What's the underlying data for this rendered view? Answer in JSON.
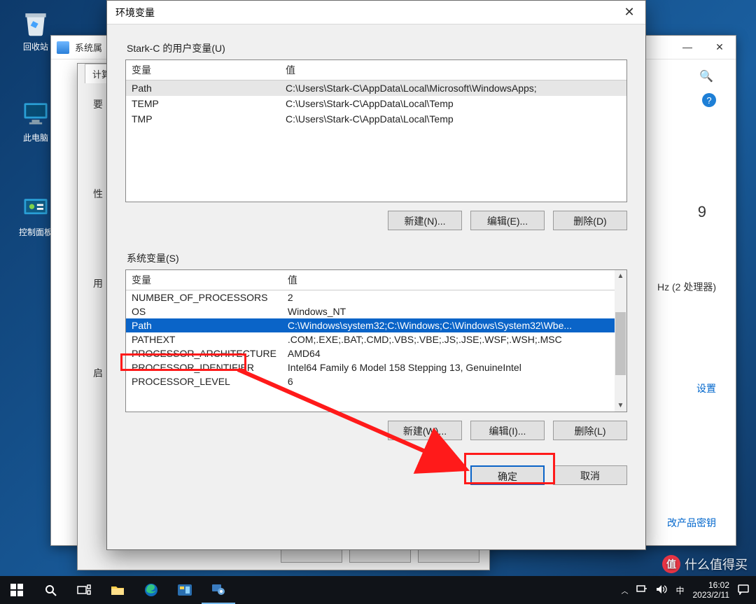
{
  "desktop": {
    "recycle": "回收站",
    "thispc": "此电脑",
    "cpanel": "控制面板"
  },
  "sys_window": {
    "title": "系统属",
    "search_glyph": "🔍",
    "help_glyph": "?",
    "minimize": "—",
    "close": "✕",
    "hz_note": "Hz  (2 处理器)",
    "nine": "9",
    "link_settings": "设置",
    "link_product": "改产品密钥"
  },
  "sub2": {
    "tab": "计算",
    "left_items": [
      "要",
      "性",
      "用",
      "启"
    ]
  },
  "dlg": {
    "title": "环境变量",
    "close": "✕",
    "user_section": "Stark-C 的用户变量(U)",
    "sys_section": "系统变量(S)",
    "col_var": "变量",
    "col_val": "值",
    "user_rows": [
      {
        "var": "Path",
        "val": "C:\\Users\\Stark-C\\AppData\\Local\\Microsoft\\WindowsApps;"
      },
      {
        "var": "TEMP",
        "val": "C:\\Users\\Stark-C\\AppData\\Local\\Temp"
      },
      {
        "var": "TMP",
        "val": "C:\\Users\\Stark-C\\AppData\\Local\\Temp"
      }
    ],
    "sys_rows": [
      {
        "var": "NUMBER_OF_PROCESSORS",
        "val": "2"
      },
      {
        "var": "OS",
        "val": "Windows_NT"
      },
      {
        "var": "Path",
        "val": "C:\\Windows\\system32;C:\\Windows;C:\\Windows\\System32\\Wbe..."
      },
      {
        "var": "PATHEXT",
        "val": ".COM;.EXE;.BAT;.CMD;.VBS;.VBE;.JS;.JSE;.WSF;.WSH;.MSC"
      },
      {
        "var": "PROCESSOR_ARCHITECTURE",
        "val": "AMD64"
      },
      {
        "var": "PROCESSOR_IDENTIFIER",
        "val": "Intel64 Family 6 Model 158 Stepping 13, GenuineIntel"
      },
      {
        "var": "PROCESSOR_LEVEL",
        "val": "6"
      }
    ],
    "btn_new_u": "新建(N)...",
    "btn_edit_u": "编辑(E)...",
    "btn_del_u": "删除(D)",
    "btn_new_s": "新建(W)...",
    "btn_edit_s": "编辑(I)...",
    "btn_del_s": "删除(L)",
    "btn_ok": "确定",
    "btn_cancel": "取消"
  },
  "taskbar": {
    "time": "16:02",
    "date": "2023/2/11",
    "ime": "中"
  },
  "watermark": {
    "text": "什么值得买",
    "logo": "值"
  }
}
